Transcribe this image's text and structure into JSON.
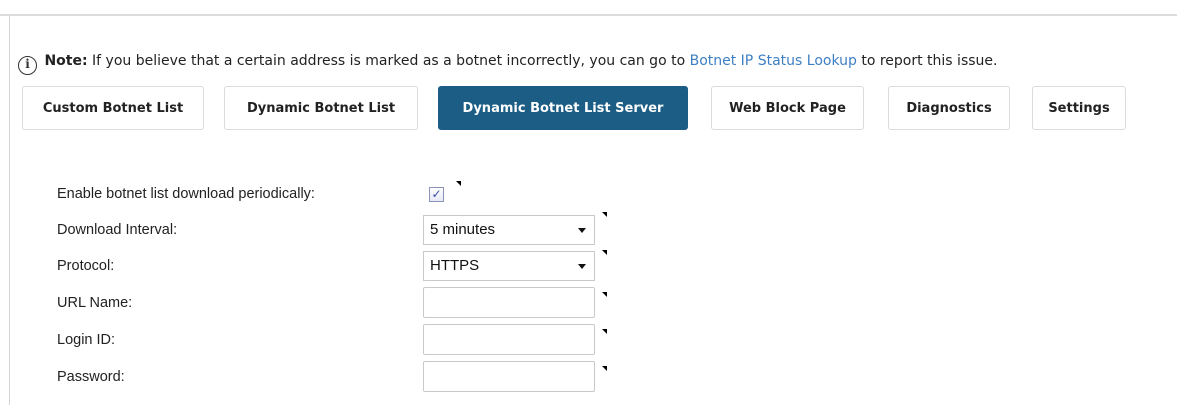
{
  "note": {
    "icon": "info-icon",
    "label": "Note:",
    "text_before": "If you believe that a certain address is marked as a botnet incorrectly, you can go to",
    "link": "Botnet IP Status Lookup",
    "text_after": "to report this issue."
  },
  "tabs": [
    {
      "label": "Custom Botnet List",
      "active": false
    },
    {
      "label": "Dynamic Botnet List",
      "active": false
    },
    {
      "label": "Dynamic Botnet List Server",
      "active": true
    },
    {
      "label": "Web Block Page",
      "active": false
    },
    {
      "label": "Diagnostics",
      "active": false
    },
    {
      "label": "Settings",
      "active": false
    }
  ],
  "form": {
    "enable_periodic": {
      "label": "Enable botnet list download periodically:",
      "checked": true
    },
    "download_interval": {
      "label": "Download Interval:",
      "value": "5 minutes"
    },
    "protocol": {
      "label": "Protocol:",
      "value": "HTTPS"
    },
    "url_name": {
      "label": "URL Name:",
      "value": ""
    },
    "login_id": {
      "label": "Login ID:",
      "value": ""
    },
    "password": {
      "label": "Password:",
      "value": ""
    }
  },
  "colors": {
    "active_tab": "#1b5d85",
    "link": "#3d7fc4"
  }
}
